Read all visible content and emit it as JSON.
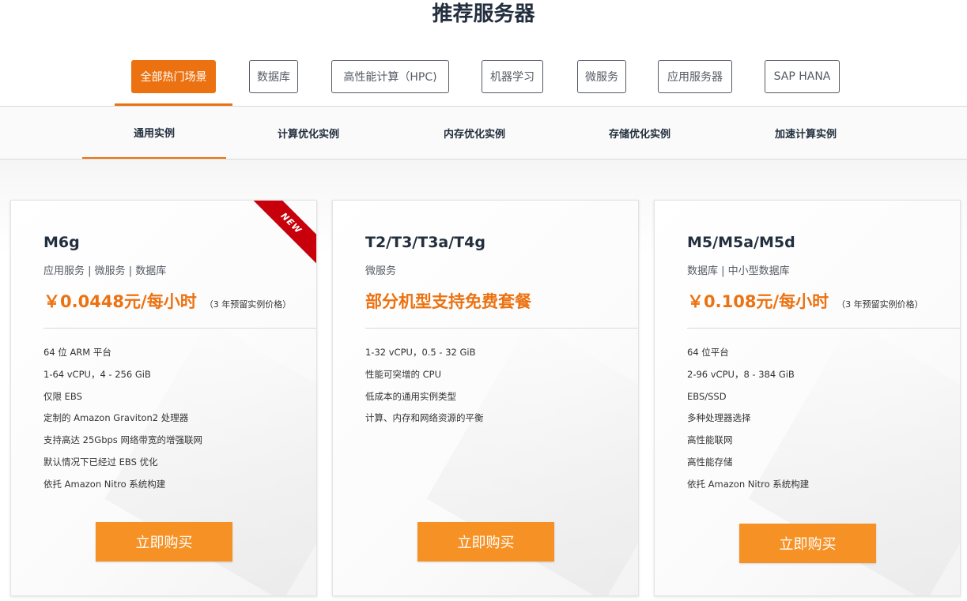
{
  "page": {
    "title": "推荐服务器"
  },
  "scenarios": [
    {
      "label": "全部热门场景",
      "active": true
    },
    {
      "label": "数据库",
      "active": false
    },
    {
      "label": "高性能计算（HPC)",
      "active": false
    },
    {
      "label": "机器学习",
      "active": false
    },
    {
      "label": "微服务",
      "active": false
    },
    {
      "label": "应用服务器",
      "active": false
    },
    {
      "label": "SAP HANA",
      "active": false
    }
  ],
  "instance_tabs": [
    {
      "label": "通用实例",
      "active": true
    },
    {
      "label": "计算优化实例",
      "active": false
    },
    {
      "label": "内存优化实例",
      "active": false
    },
    {
      "label": "存储优化实例",
      "active": false
    },
    {
      "label": "加速计算实例",
      "active": false
    }
  ],
  "colors": {
    "accent": "#ec7211",
    "button": "#f69225",
    "ribbon": "#c7000b",
    "title": "#232f3e"
  },
  "cards": [
    {
      "title": "M6g",
      "tags": "应用服务 | 微服务 | 数据库",
      "price": "￥0.0448元/每小时",
      "price_note": "（3 年预留实例价格）",
      "badge": "NEW",
      "features": [
        "64 位 ARM 平台",
        "1-64 vCPU，4 - 256 GiB",
        "仅限 EBS",
        "定制的 Amazon Graviton2 处理器",
        "支持高达 25Gbps 网络带宽的增强联网",
        "默认情况下已经过 EBS 优化",
        "依托 Amazon Nitro 系统构建"
      ],
      "button": "立即购买"
    },
    {
      "title": "T2/T3/T3a/T4g",
      "tags": "微服务",
      "price": "部分机型支持免费套餐",
      "price_note": "",
      "badge": "",
      "features": [
        "1-32 vCPU，0.5 - 32 GiB",
        "性能可突增的 CPU",
        "低成本的通用实例类型",
        "计算、内存和网络资源的平衡"
      ],
      "button": "立即购买"
    },
    {
      "title": "M5/M5a/M5d",
      "tags": "数据库 | 中小型数据库",
      "price": "￥0.108元/每小时",
      "price_note": "（3 年预留实例价格）",
      "badge": "",
      "features": [
        "64 位平台",
        "2-96 vCPU，8 - 384 GiB",
        "EBS/SSD",
        "多种处理器选择",
        "高性能联网",
        "高性能存储",
        "依托 Amazon Nitro 系统构建"
      ],
      "button": "立即购买"
    }
  ]
}
